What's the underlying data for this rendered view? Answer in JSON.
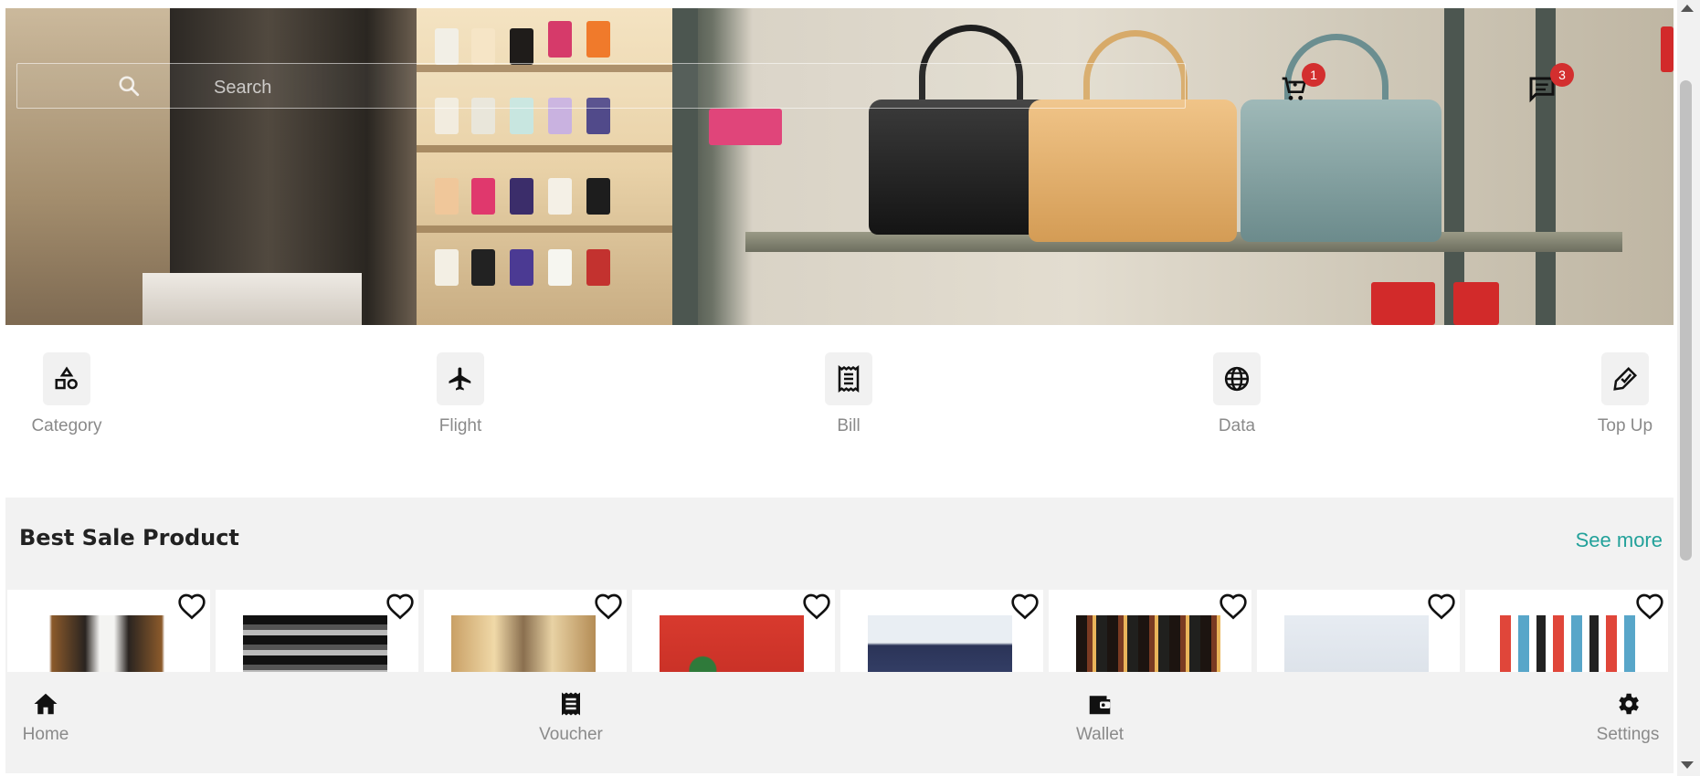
{
  "header": {
    "search_placeholder": "Search",
    "cart_badge": "1",
    "chat_badge": "3",
    "icons": {
      "search": "search-icon",
      "cart": "cart-icon",
      "chat": "chat-icon"
    }
  },
  "categories": [
    {
      "label": "Category",
      "icon": "shapes-icon"
    },
    {
      "label": "Flight",
      "icon": "airplane-icon"
    },
    {
      "label": "Bill",
      "icon": "receipt-icon"
    },
    {
      "label": "Data",
      "icon": "globe-icon"
    },
    {
      "label": "Top Up",
      "icon": "tag-check-icon"
    }
  ],
  "best_sale": {
    "title": "Best Sale Product",
    "see_more": "See more",
    "products": [
      {
        "image": "jacket-hoodie"
      },
      {
        "image": "clothing-store-bw"
      },
      {
        "image": "store-interior"
      },
      {
        "image": "floral-shirt"
      },
      {
        "image": "knit-sweater"
      },
      {
        "image": "clothes-rack"
      },
      {
        "image": "folded-jeans"
      },
      {
        "image": "microphones"
      }
    ]
  },
  "bottom_nav": [
    {
      "label": "Home",
      "icon": "home-icon"
    },
    {
      "label": "Voucher",
      "icon": "voucher-icon"
    },
    {
      "label": "Wallet",
      "icon": "wallet-icon"
    },
    {
      "label": "Settings",
      "icon": "gear-icon"
    }
  ],
  "colors": {
    "accent": "#22a19a",
    "badge": "#d32f2f",
    "section_bg": "#f2f2f2"
  }
}
